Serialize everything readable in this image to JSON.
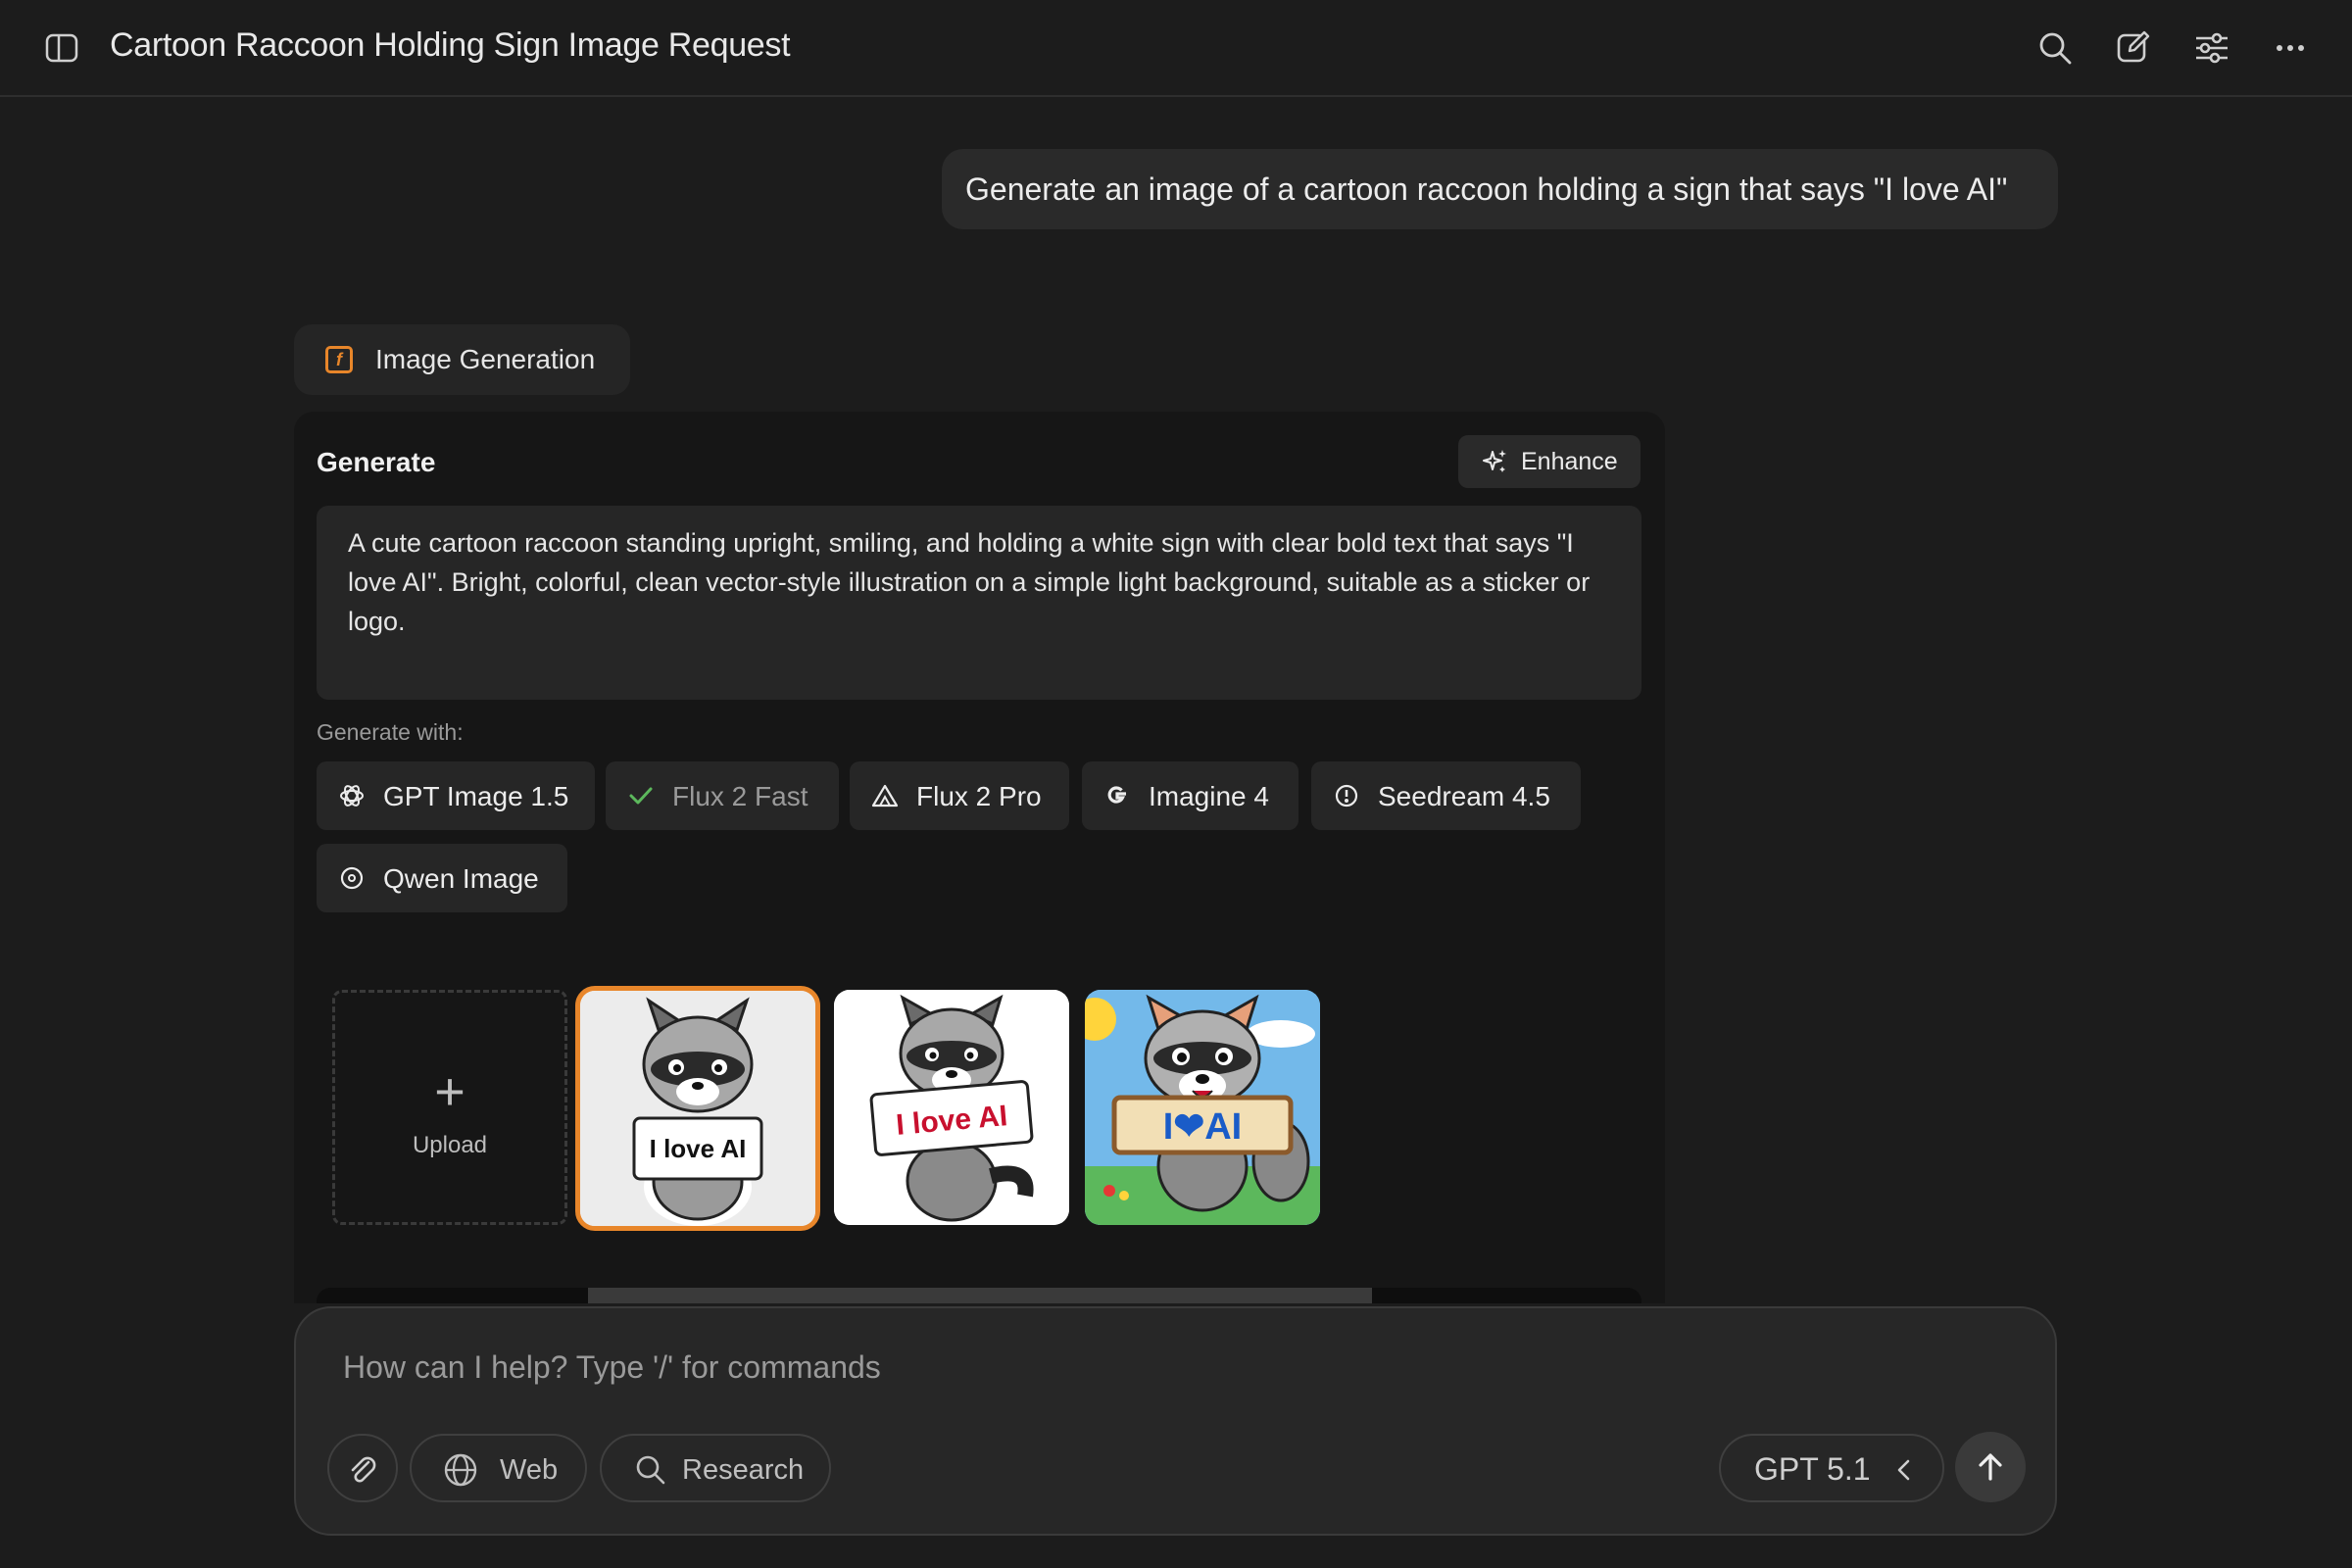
{
  "header": {
    "title": "Cartoon Raccoon Holding Sign Image Request",
    "icons": [
      "sidebar-toggle-icon",
      "search-icon",
      "new-chat-icon",
      "settings-sliders-icon",
      "more-icon"
    ]
  },
  "user_message": "Generate an image of a cartoon raccoon holding a sign that says \"I love AI\"",
  "tool_chip": {
    "label": "Image Generation"
  },
  "generate_panel": {
    "title": "Generate",
    "enhance_label": "Enhance",
    "prompt": "A cute cartoon raccoon standing upright, smiling, and holding a white sign with clear bold text that says \"I love AI\". Bright, colorful, clean vector-style illustration on a simple light background, suitable as a sticker or logo.",
    "generate_with_label": "Generate with:",
    "models": [
      {
        "label": "GPT Image 1.5",
        "icon": "openai-icon",
        "selected": false
      },
      {
        "label": "Flux 2 Fast",
        "icon": "check-icon",
        "selected": true
      },
      {
        "label": "Flux 2 Pro",
        "icon": "flux-icon",
        "selected": false
      },
      {
        "label": "Imagine 4",
        "icon": "google-icon",
        "selected": false
      },
      {
        "label": "Seedream 4.5",
        "icon": "seedream-icon",
        "selected": false
      },
      {
        "label": "Qwen Image",
        "icon": "qwen-icon",
        "selected": false
      }
    ],
    "upload_label": "Upload",
    "thumbnails": [
      {
        "sign_text": "I love AI",
        "selected": true
      },
      {
        "sign_text": "I love AI",
        "selected": false
      },
      {
        "sign_text": "I❤AI",
        "selected": false
      }
    ]
  },
  "composer": {
    "placeholder": "How can I help? Type '/' for commands",
    "web_label": "Web",
    "research_label": "Research",
    "model_label": "GPT 5.1"
  },
  "colors": {
    "background": "#1c1c1c",
    "accent": "#e8862a",
    "check": "#5cb85c"
  }
}
